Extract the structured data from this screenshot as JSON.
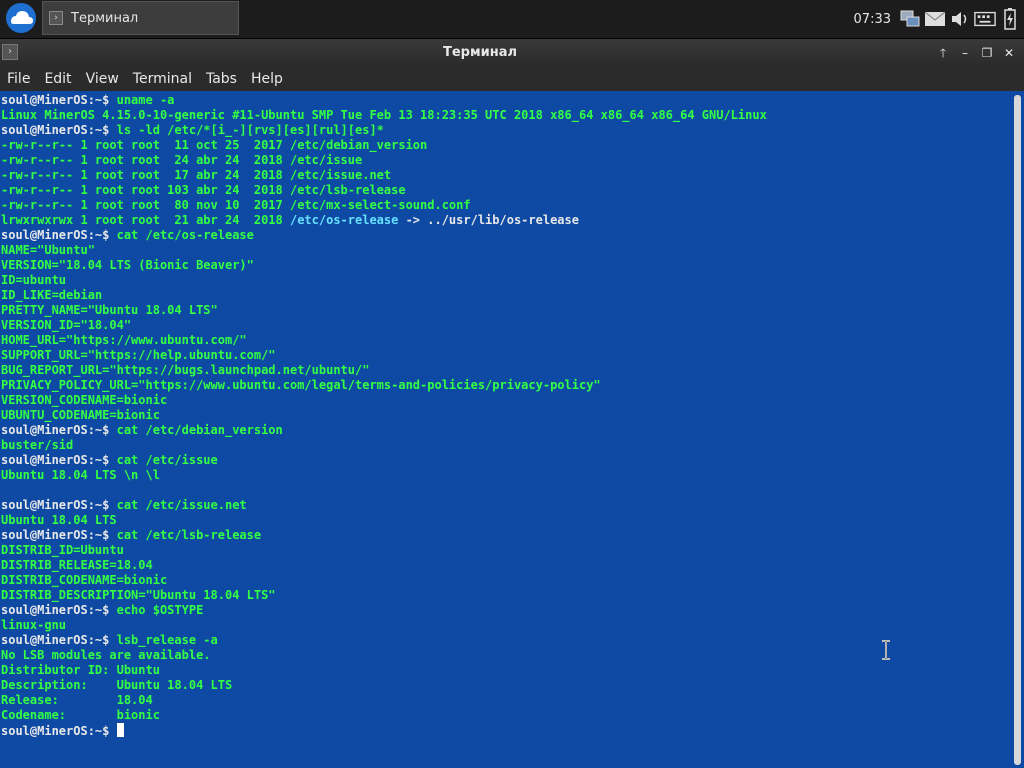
{
  "taskbar": {
    "task_label": "Терминал",
    "clock": "07:33"
  },
  "window": {
    "title": "Терминал"
  },
  "menu": [
    "File",
    "Edit",
    "View",
    "Terminal",
    "Tabs",
    "Help"
  ],
  "prompt": "soul@MinerOS:~$ ",
  "terminal_lines": [
    {
      "type": "prompt",
      "text": "uname -a"
    },
    {
      "type": "out",
      "text": "Linux MinerOS 4.15.0-10-generic #11-Ubuntu SMP Tue Feb 13 18:23:35 UTC 2018 x86_64 x86_64 x86_64 GNU/Linux"
    },
    {
      "type": "prompt",
      "text": "ls -ld /etc/*[i_-][rvs][es][rul][es]*"
    },
    {
      "type": "out",
      "text": "-rw-r--r-- 1 root root  11 oct 25  2017 /etc/debian_version"
    },
    {
      "type": "out",
      "text": "-rw-r--r-- 1 root root  24 abr 24  2018 /etc/issue"
    },
    {
      "type": "out",
      "text": "-rw-r--r-- 1 root root  17 abr 24  2018 /etc/issue.net"
    },
    {
      "type": "out",
      "text": "-rw-r--r-- 1 root root 103 abr 24  2018 /etc/lsb-release"
    },
    {
      "type": "out",
      "text": "-rw-r--r-- 1 root root  80 nov 10  2017 /etc/mx-select-sound.conf"
    },
    {
      "type": "symlink",
      "text": "lrwxrwxrwx 1 root root  21 abr 24  2018 ",
      "link": "/etc/os-release",
      "target": " -> ../usr/lib/os-release"
    },
    {
      "type": "prompt",
      "text": "cat /etc/os-release"
    },
    {
      "type": "out",
      "text": "NAME=\"Ubuntu\""
    },
    {
      "type": "out",
      "text": "VERSION=\"18.04 LTS (Bionic Beaver)\""
    },
    {
      "type": "out",
      "text": "ID=ubuntu"
    },
    {
      "type": "out",
      "text": "ID_LIKE=debian"
    },
    {
      "type": "out",
      "text": "PRETTY_NAME=\"Ubuntu 18.04 LTS\""
    },
    {
      "type": "out",
      "text": "VERSION_ID=\"18.04\""
    },
    {
      "type": "out",
      "text": "HOME_URL=\"https://www.ubuntu.com/\""
    },
    {
      "type": "out",
      "text": "SUPPORT_URL=\"https://help.ubuntu.com/\""
    },
    {
      "type": "out",
      "text": "BUG_REPORT_URL=\"https://bugs.launchpad.net/ubuntu/\""
    },
    {
      "type": "out",
      "text": "PRIVACY_POLICY_URL=\"https://www.ubuntu.com/legal/terms-and-policies/privacy-policy\""
    },
    {
      "type": "out",
      "text": "VERSION_CODENAME=bionic"
    },
    {
      "type": "out",
      "text": "UBUNTU_CODENAME=bionic"
    },
    {
      "type": "prompt",
      "text": "cat /etc/debian_version"
    },
    {
      "type": "out",
      "text": "buster/sid"
    },
    {
      "type": "prompt",
      "text": "cat /etc/issue"
    },
    {
      "type": "out",
      "text": "Ubuntu 18.04 LTS \\n \\l"
    },
    {
      "type": "out",
      "text": ""
    },
    {
      "type": "prompt",
      "text": "cat /etc/issue.net"
    },
    {
      "type": "out",
      "text": "Ubuntu 18.04 LTS"
    },
    {
      "type": "prompt",
      "text": "cat /etc/lsb-release"
    },
    {
      "type": "out",
      "text": "DISTRIB_ID=Ubuntu"
    },
    {
      "type": "out",
      "text": "DISTRIB_RELEASE=18.04"
    },
    {
      "type": "out",
      "text": "DISTRIB_CODENAME=bionic"
    },
    {
      "type": "out",
      "text": "DISTRIB_DESCRIPTION=\"Ubuntu 18.04 LTS\""
    },
    {
      "type": "prompt",
      "text": "echo $OSTYPE"
    },
    {
      "type": "out",
      "text": "linux-gnu"
    },
    {
      "type": "prompt",
      "text": "lsb_release -a"
    },
    {
      "type": "out",
      "text": "No LSB modules are available."
    },
    {
      "type": "out",
      "text": "Distributor ID:\tUbuntu"
    },
    {
      "type": "out",
      "text": "Description:\tUbuntu 18.04 LTS"
    },
    {
      "type": "out",
      "text": "Release:\t18.04"
    },
    {
      "type": "out",
      "text": "Codename:\tbionic"
    },
    {
      "type": "current",
      "text": ""
    }
  ],
  "colors": {
    "terminal_bg": "#0e4aa3",
    "output": "#33ff44",
    "prompt": "#e8e8e8",
    "symlink": "#66e0ff"
  },
  "icons": [
    "cloud-launcher-icon",
    "terminal-icon",
    "network-icon",
    "mail-icon",
    "volume-icon",
    "keyboard-icon",
    "battery-icon",
    "window-menu-icon",
    "keep-above-icon",
    "minimize-icon",
    "maximize-icon",
    "close-icon",
    "ibeam-cursor-icon"
  ]
}
